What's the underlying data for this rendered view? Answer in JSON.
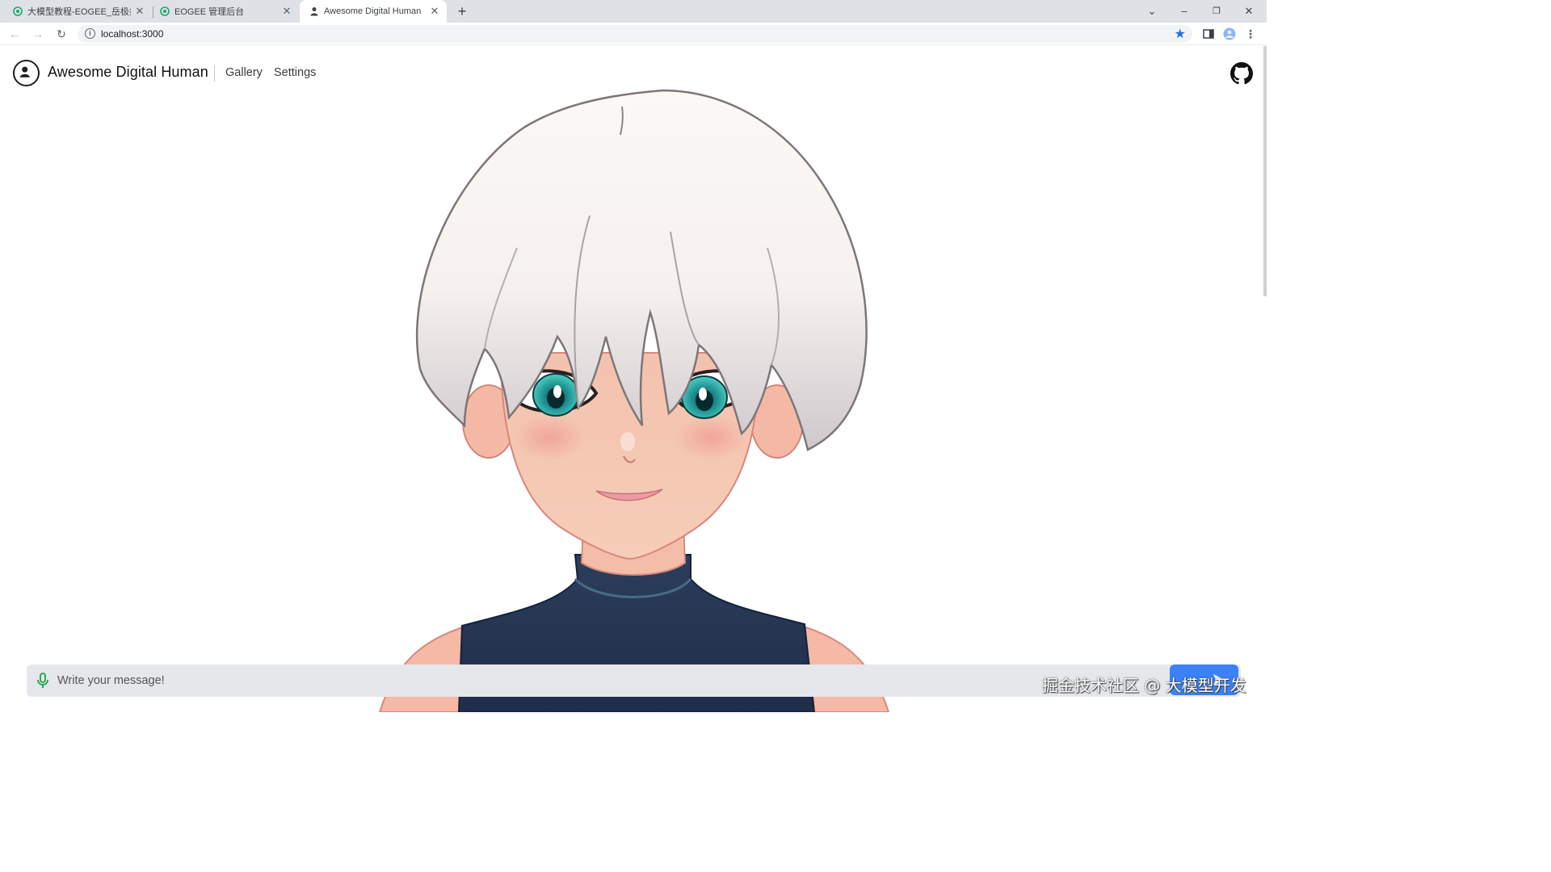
{
  "browser": {
    "tabs": [
      {
        "title": "大模型教程-EOGEE_岳极技术",
        "active": false
      },
      {
        "title": "EOGEE 管理后台",
        "active": false
      },
      {
        "title": "Awesome Digital Human",
        "active": true
      }
    ],
    "new_tab": "+",
    "url": "localhost:3000",
    "window_controls": {
      "minimize": "–",
      "restore": "❐",
      "close": "✕"
    }
  },
  "app": {
    "title": "Awesome Digital Human",
    "nav": [
      "Gallery",
      "Settings"
    ],
    "github_icon": "github-icon"
  },
  "chat": {
    "placeholder": "Write your message!",
    "mic_icon": "microphone-icon",
    "send_icon": "send-icon"
  },
  "watermark": "掘金技术社区 @ 大模型开发",
  "colors": {
    "send_button": "#3b82f6",
    "mic": "#16a34a",
    "chat_bar": "#e5e7eb",
    "bookmark_star": "#1a73e8"
  }
}
